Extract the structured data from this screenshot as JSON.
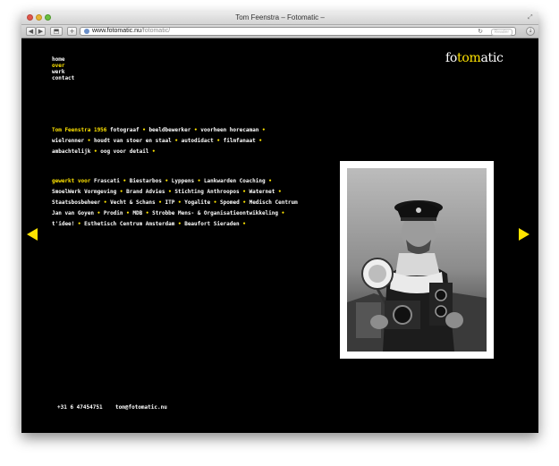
{
  "window": {
    "title": "Tom Feenstra – Fotomatic –"
  },
  "toolbar": {
    "back_icon": "back-arrow-icon",
    "forward_icon": "forward-arrow-icon",
    "share_icon": "share-icon",
    "add_label": "+",
    "url_host": "www.fotomatic.nu",
    "url_path": "/fotomatic/",
    "reader_label": "Reader"
  },
  "nav": {
    "items": [
      "home",
      "over",
      "werk",
      "contact"
    ],
    "active": "over"
  },
  "logo": {
    "part1": "fo",
    "part2": "tom",
    "part3": "atic"
  },
  "bio": {
    "name": "Tom Feenstra 1956",
    "items": [
      "fotograaf",
      "beeldbewerker",
      "voorheen horecaman",
      "wielrenner",
      "houdt van stoer en staal",
      "autodidact",
      "filmfanaat",
      "ambachtelijk",
      "oog voor detail"
    ]
  },
  "clients": {
    "label": "gewerkt voor",
    "items": [
      "Frascati",
      "Biestarbos",
      "Lyppens",
      "Lankwarden Coaching",
      "SmoelWerk Vormgeving",
      "Brand Advies",
      "Stichting Anthroopos",
      "Waternet",
      "Staatsbosbeheer",
      "Vecht & Schans",
      "ITP",
      "Yogalite",
      "Spomed",
      "Medisch Centrum Jan van Goyen",
      "Prodin",
      "MDB",
      "Strobbe Mens- & Organisatieontwikkeling",
      "t'idee!",
      "Esthetisch Centrum Amsterdam",
      "Beaufort Sieraden"
    ]
  },
  "footer": {
    "phone": "+31 6 47454751",
    "email": "tom@fotomatic.nu"
  },
  "colors": {
    "accent": "#ffe400",
    "background": "#000000",
    "text": "#ffffff"
  }
}
